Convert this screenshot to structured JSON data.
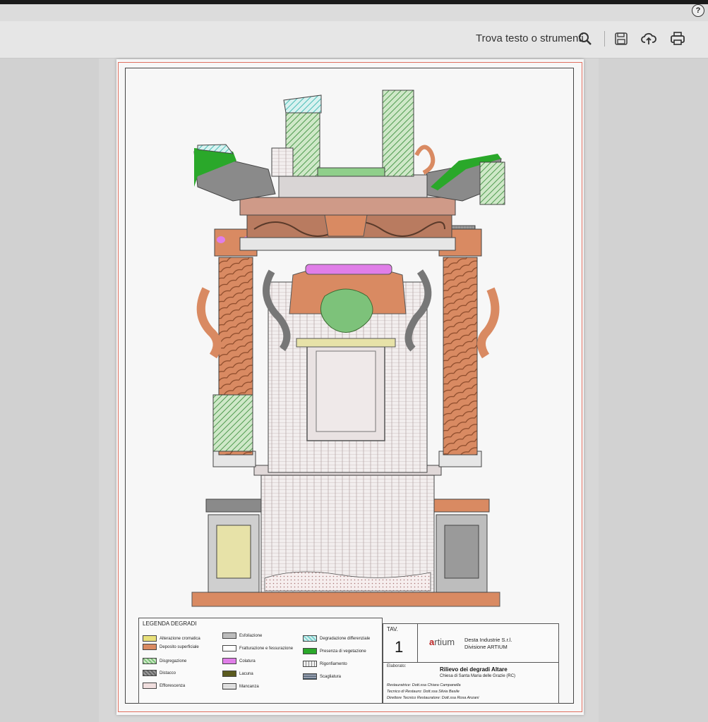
{
  "toolbar": {
    "search_label": "Trova testo o strumenti",
    "icons": [
      "search-icon",
      "save-icon",
      "upload-icon",
      "print-icon"
    ],
    "help_label": "?"
  },
  "document": {
    "legend": {
      "title": "LEGENDA DEGRADI",
      "items": [
        {
          "label": "Alterazione cromatica",
          "color": "#e8e07a"
        },
        {
          "label": "Deposito superficiale",
          "color": "#d98a62"
        },
        {
          "label": "Disgregazione",
          "color": "#7dc27a"
        },
        {
          "label": "Distacco",
          "color": "#666666"
        },
        {
          "label": "Efflorescenza",
          "color": "#f0dede"
        },
        {
          "label": "Esfoliazione",
          "color": "#bcbcbc"
        },
        {
          "label": "Fratturazione e fessurazione",
          "color": "#ffffff"
        },
        {
          "label": "Colatura",
          "color": "#e07ee8"
        },
        {
          "label": "Lacuna",
          "color": "#5a5a1e"
        },
        {
          "label": "Mancanza",
          "color": "#cfcfcf"
        },
        {
          "label": "Degradazione differenziale",
          "color": "#7ed2d0"
        },
        {
          "label": "Presenza di vegetazione",
          "color": "#2aa82a"
        },
        {
          "label": "Rigonfiamento",
          "color": "#eeeeee"
        },
        {
          "label": "Scagliatura",
          "color": "#556677"
        }
      ]
    },
    "tav": {
      "label": "TAV.",
      "number": "1"
    },
    "company": {
      "logo_mark": "a",
      "logo_text": "rtium",
      "line1": "Desta Industrie S.r.l.",
      "line2": "Divisione ARTIUM"
    },
    "elaborato": {
      "label": "Elaborato:",
      "title": "Rilievo dei degradi Altare",
      "subtitle": "Chiesa di Santa Maria delle Grazie (RC)"
    },
    "credits": [
      "Restauratrice: Dott.ssa Chiara Campanella",
      "Tecnico di Restauro: Dott.ssa Silvia Basile",
      "Direttore Tecnico Restauratore: Dott.ssa Rosa Anzani"
    ]
  }
}
